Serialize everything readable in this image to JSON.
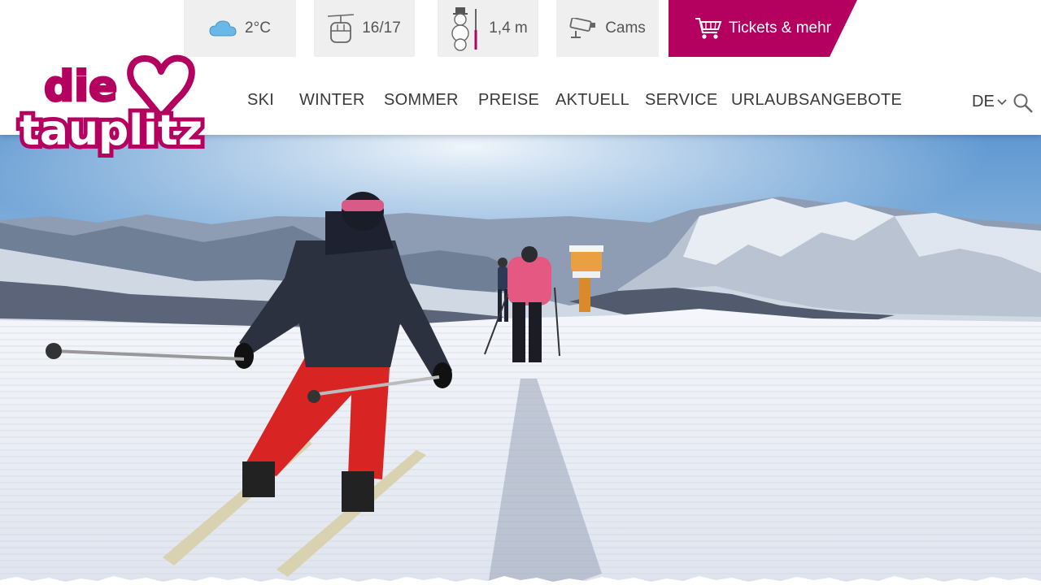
{
  "topbar": {
    "weather": {
      "icon": "cloud-icon",
      "label": "2°C"
    },
    "lifts": {
      "icon": "gondola-icon",
      "label": "16/17"
    },
    "snow": {
      "icon": "snowman-icon",
      "label": "1,4 m"
    },
    "cams": {
      "icon": "camera-icon",
      "label": "Cams"
    },
    "tickets": {
      "icon": "cart-icon",
      "label": "Tickets & mehr"
    }
  },
  "logo": {
    "line1": "die",
    "line2": "tauplitz"
  },
  "nav": {
    "items": [
      "SKI",
      "WINTER",
      "SOMMER",
      "PREISE",
      "AKTUELL",
      "SERVICE",
      "URLAUBSANGEBOTE"
    ]
  },
  "language": {
    "label": "DE"
  },
  "colors": {
    "brand": "#b4005e",
    "topbar_bg": "#efefef",
    "text": "#3a3a3a"
  }
}
